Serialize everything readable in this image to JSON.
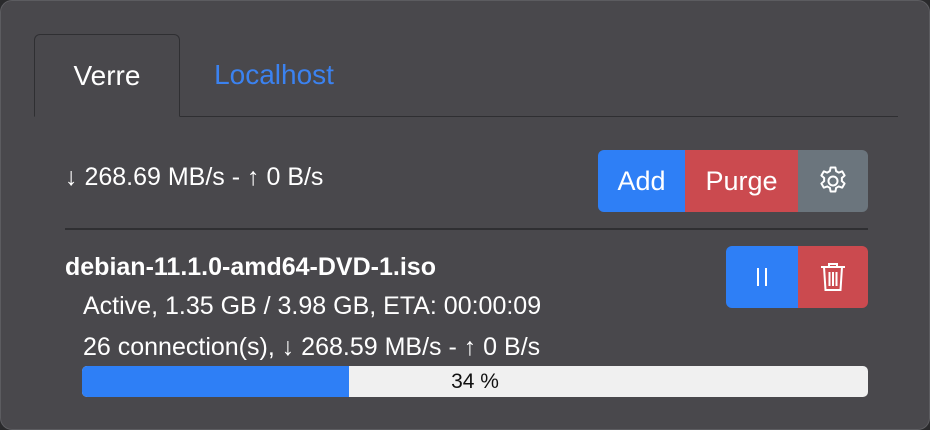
{
  "tabs": [
    {
      "label": "Verre",
      "active": true
    },
    {
      "label": "Localhost",
      "active": false
    }
  ],
  "summary": {
    "text": "↓ 268.69 MB/s - ↑ 0 B/s"
  },
  "toolbar": {
    "add_label": "Add",
    "purge_label": "Purge",
    "settings_icon": "gear-icon"
  },
  "download": {
    "name": "debian-11.1.0-amd64-DVD-1.iso",
    "status": "Active, 1.35 GB / 3.98 GB, ETA: 00:00:09",
    "connections": "26 connection(s), ↓ 268.59 MB/s - ↑ 0 B/s",
    "progress_percent": 34,
    "progress_label": "34 %",
    "pause_icon": "pause-icon",
    "delete_icon": "trash-icon"
  },
  "colors": {
    "primary": "#2e7ff6",
    "danger": "#cb4a4f",
    "secondary": "#6b757d",
    "link": "#3b82f0",
    "background": "#49484c"
  }
}
